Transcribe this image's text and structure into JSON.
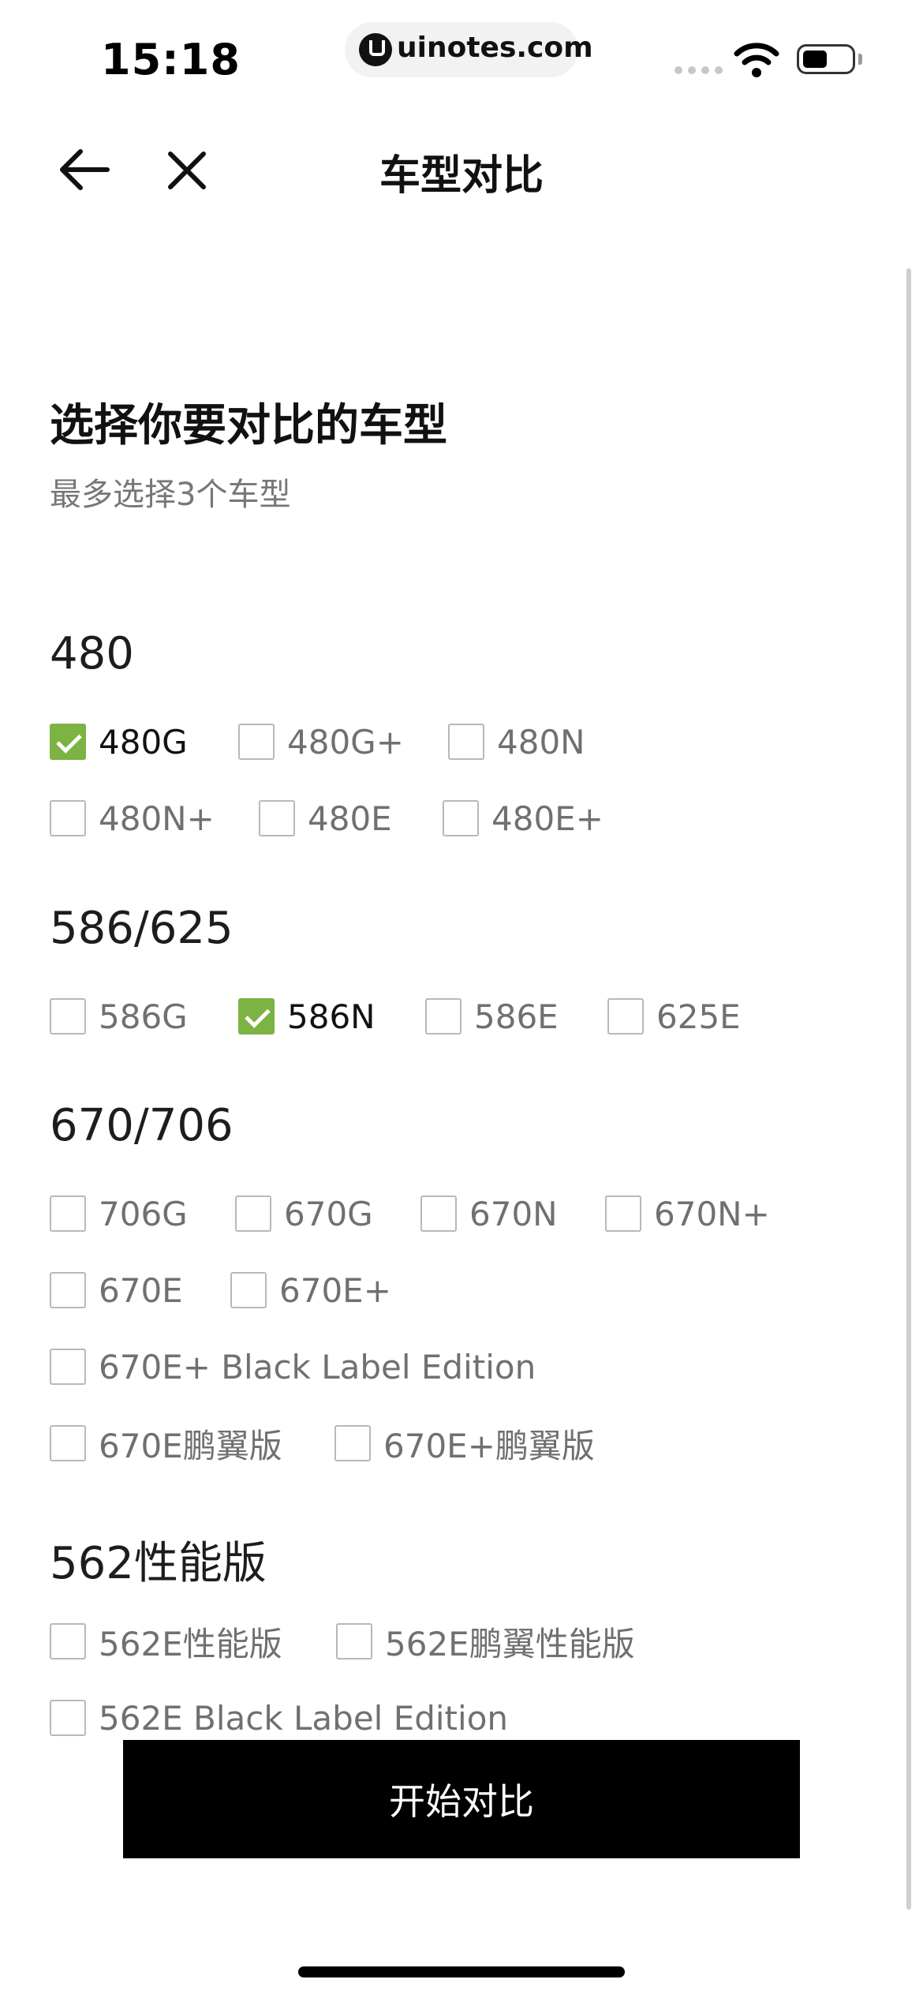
{
  "status_bar": {
    "time": "15:18",
    "url": "uinotes.com"
  },
  "nav": {
    "title": "车型对比",
    "back_icon": "arrow-left-icon",
    "close_icon": "close-icon"
  },
  "header": {
    "title": "选择你要对比的车型",
    "subtitle": "最多选择3个车型"
  },
  "groups": [
    {
      "title": "480",
      "options": [
        {
          "label": "480G",
          "checked": true
        },
        {
          "label": "480G+",
          "checked": false
        },
        {
          "label": "480N",
          "checked": false
        },
        {
          "label": "480N+",
          "checked": false
        },
        {
          "label": "480E",
          "checked": false
        },
        {
          "label": "480E+",
          "checked": false
        }
      ]
    },
    {
      "title": "586/625",
      "options": [
        {
          "label": "586G",
          "checked": false
        },
        {
          "label": "586N",
          "checked": true
        },
        {
          "label": "586E",
          "checked": false
        },
        {
          "label": "625E",
          "checked": false
        }
      ]
    },
    {
      "title": "670/706",
      "options": [
        {
          "label": "706G",
          "checked": false
        },
        {
          "label": "670G",
          "checked": false
        },
        {
          "label": "670N",
          "checked": false
        },
        {
          "label": "670N+",
          "checked": false
        },
        {
          "label": "670E",
          "checked": false
        },
        {
          "label": "670E+",
          "checked": false
        },
        {
          "label": "670E+ Black Label Edition",
          "checked": false
        },
        {
          "label": "670E鹏翼版",
          "checked": false
        },
        {
          "label": "670E+鹏翼版",
          "checked": false
        }
      ]
    },
    {
      "title": "562性能版",
      "options": [
        {
          "label": "562E性能版",
          "checked": false
        },
        {
          "label": "562E鹏翼性能版",
          "checked": false
        },
        {
          "label": "562E Black Label Edition",
          "checked": false
        }
      ]
    }
  ],
  "cta": {
    "label": "开始对比"
  },
  "colors": {
    "checked": "#7cb342",
    "cta_background": "#000000"
  }
}
